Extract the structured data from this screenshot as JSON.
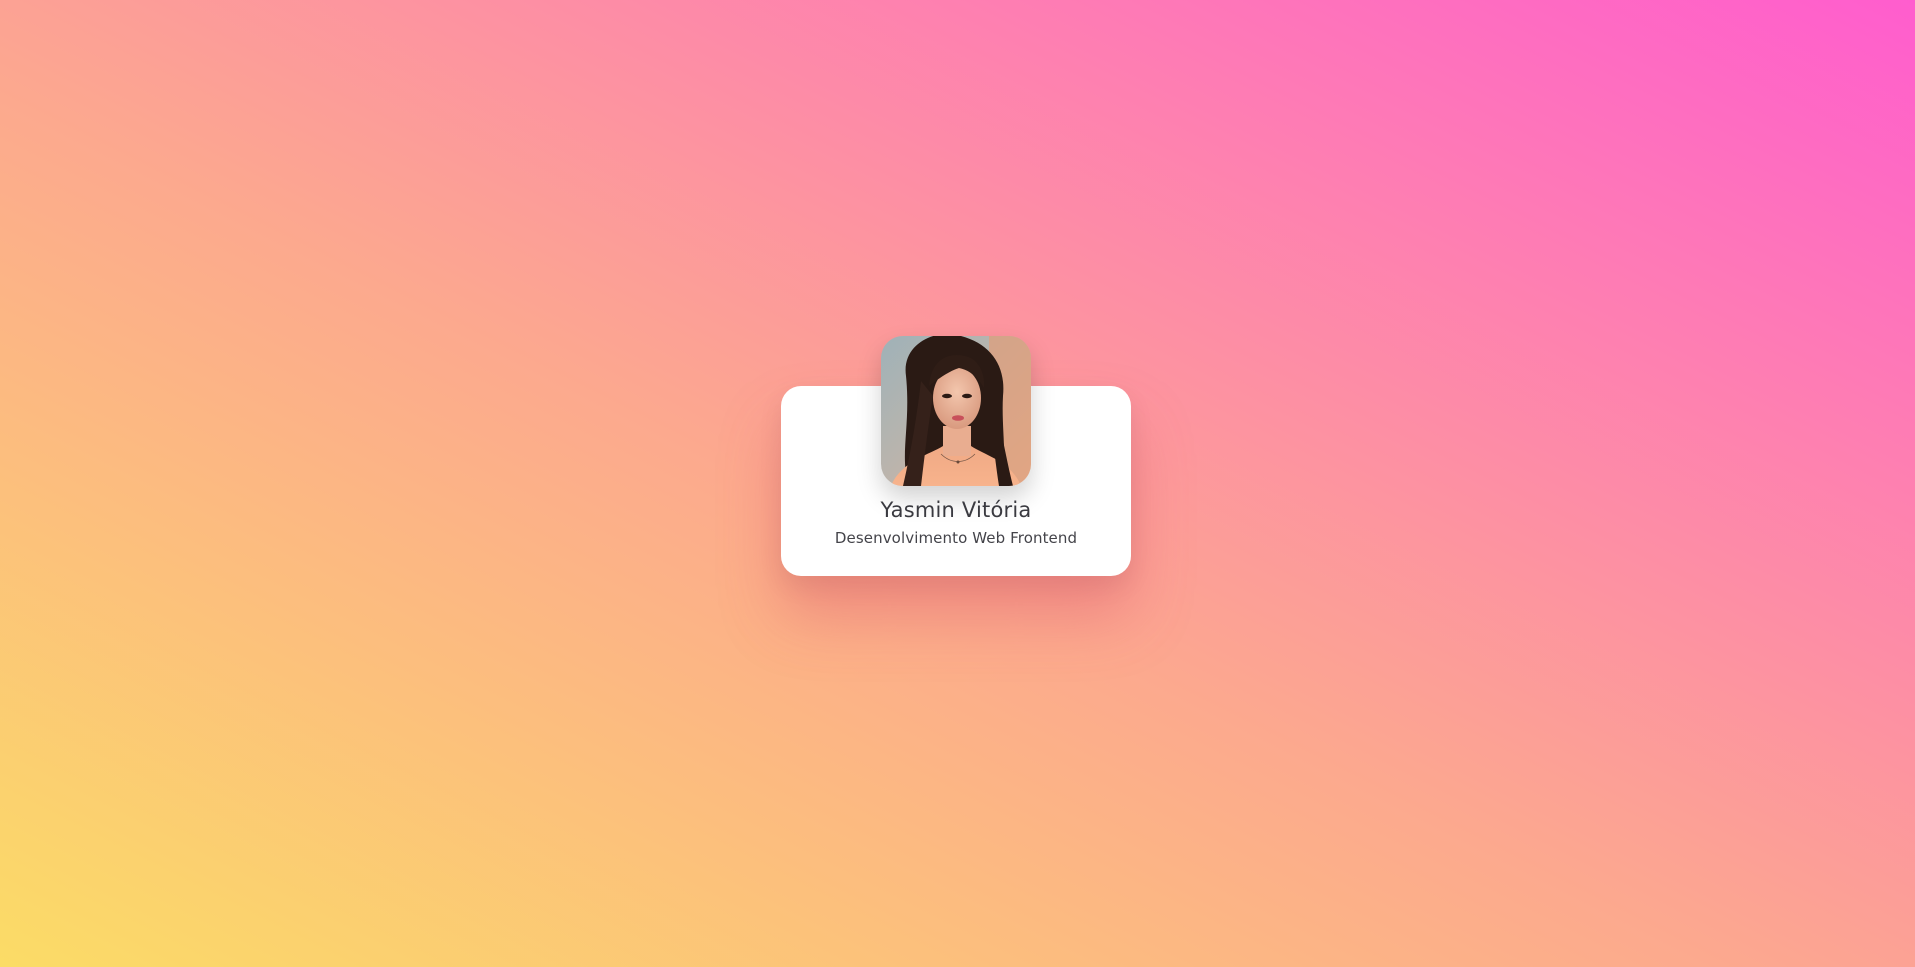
{
  "background": {
    "gradient_from": "#fbd966",
    "gradient_mid": "#fca98d",
    "gradient_to": "#ff5fcd"
  },
  "profile_card": {
    "name": "Yasmin Vitória",
    "role": "Desenvolvimento Web Frontend",
    "avatar_icon": "profile-photo"
  }
}
